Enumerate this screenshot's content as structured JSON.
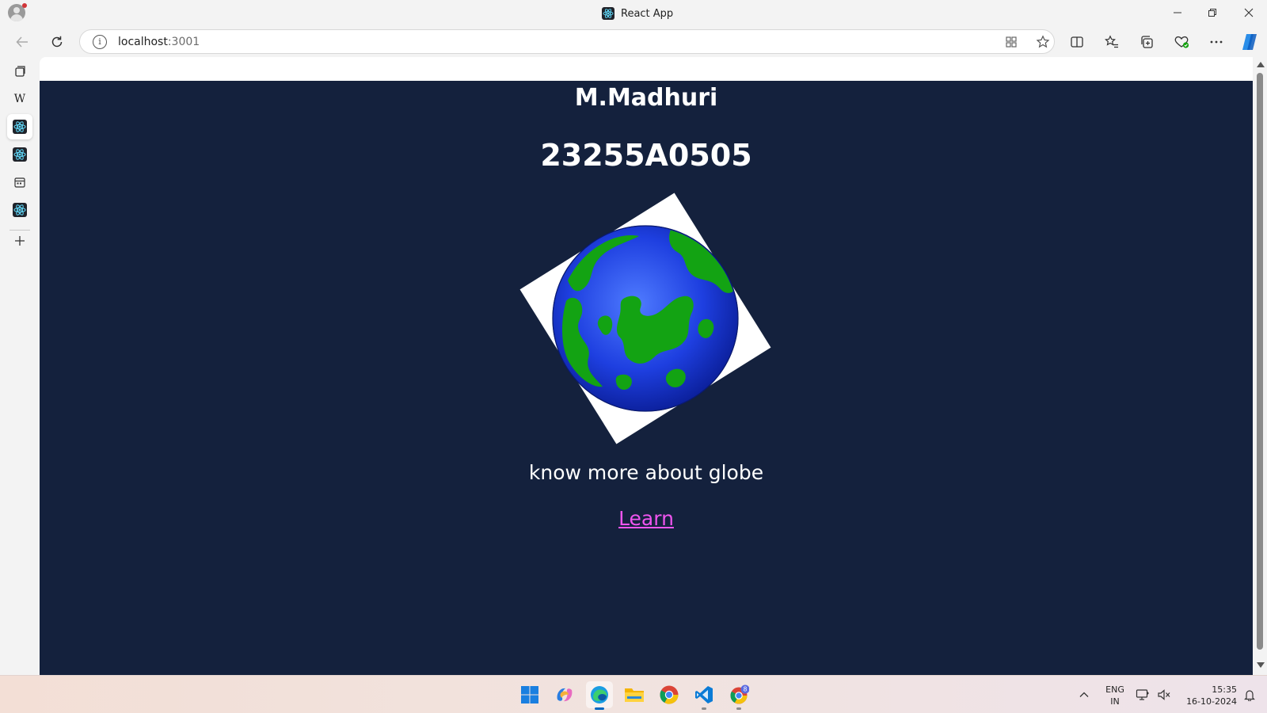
{
  "browser": {
    "window_title": "React App",
    "url_host": "localhost",
    "url_port": ":3001"
  },
  "page": {
    "name": "M.Madhuri",
    "roll_number": "23255A0505",
    "tagline": "know more about globe",
    "link_label": "Learn"
  },
  "colors": {
    "page_background": "#14213d",
    "link": "#ee55ee",
    "globe_ocean": "#1a3fd0",
    "globe_land": "#13a313"
  },
  "sidebar": {
    "tabs": [
      {
        "icon": "tab-actions-icon"
      },
      {
        "icon": "wikipedia-icon",
        "label": "W"
      },
      {
        "icon": "react-icon"
      },
      {
        "icon": "react-icon"
      },
      {
        "icon": "calendar-icon"
      },
      {
        "icon": "react-icon"
      }
    ]
  },
  "taskbar": {
    "apps": [
      "start-icon",
      "copilot-icon",
      "edge-icon",
      "file-explorer-icon",
      "chrome-icon",
      "vscode-icon",
      "chrome-profile-icon"
    ],
    "badge": "8",
    "language": "ENG",
    "region": "IN",
    "time": "15:35",
    "date": "16-10-2024"
  }
}
